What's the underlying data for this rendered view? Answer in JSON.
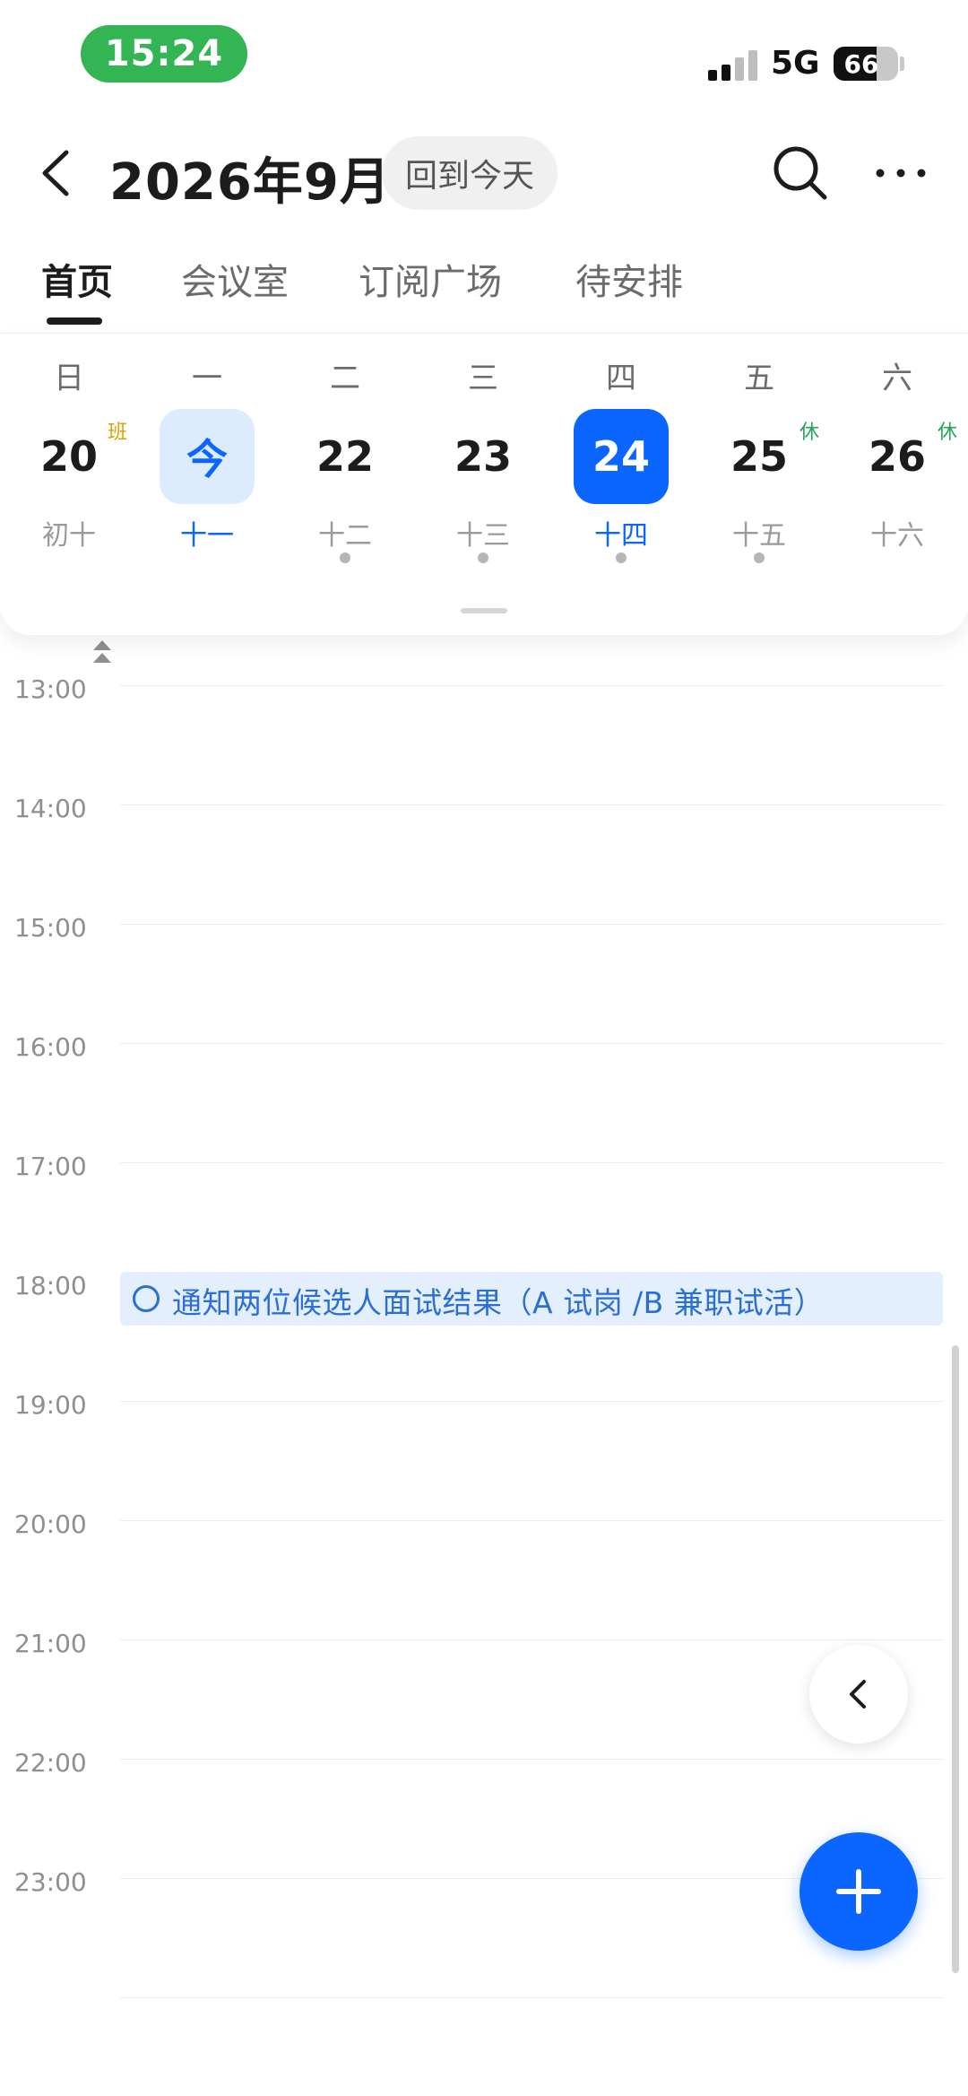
{
  "status_bar": {
    "time": "15:24",
    "network": "5G",
    "battery": "66",
    "battery_level": 0.66
  },
  "header": {
    "title": "2026年9月",
    "today_button": "回到今天"
  },
  "tabs": [
    "首页",
    "会议室",
    "订阅广场",
    "待安排"
  ],
  "week": {
    "days": [
      {
        "weekday": "日",
        "date": "20",
        "lunar": "初十",
        "badge": "班"
      },
      {
        "weekday": "一",
        "date": "今",
        "lunar": "十一"
      },
      {
        "weekday": "二",
        "date": "22",
        "lunar": "十二"
      },
      {
        "weekday": "三",
        "date": "23",
        "lunar": "十三"
      },
      {
        "weekday": "四",
        "date": "24",
        "lunar": "十四"
      },
      {
        "weekday": "五",
        "date": "25",
        "lunar": "十五",
        "badge": "休"
      },
      {
        "weekday": "六",
        "date": "26",
        "lunar": "十六",
        "badge": "休"
      }
    ]
  },
  "timeline": {
    "hours": [
      "13:00",
      "14:00",
      "15:00",
      "16:00",
      "17:00",
      "18:00",
      "19:00",
      "20:00",
      "21:00",
      "22:00",
      "23:00"
    ],
    "event": {
      "title": "通知两位候选人面试结果（A 试岗 /B 兼职试活）"
    }
  },
  "colors": {
    "accent": "#0a66ff",
    "today_bg": "#ddebff",
    "event_bg": "#e3effd",
    "work_badge": "#e0a100",
    "rest_badge": "#23a55a",
    "status_pill": "#34b554"
  },
  "icons": {
    "back": "chevron-left-icon",
    "search": "search-icon",
    "more": "more-icon",
    "collapse": "double-chevron-up-icon",
    "fab_collapse": "chevron-left-icon",
    "fab_add": "plus-icon"
  }
}
